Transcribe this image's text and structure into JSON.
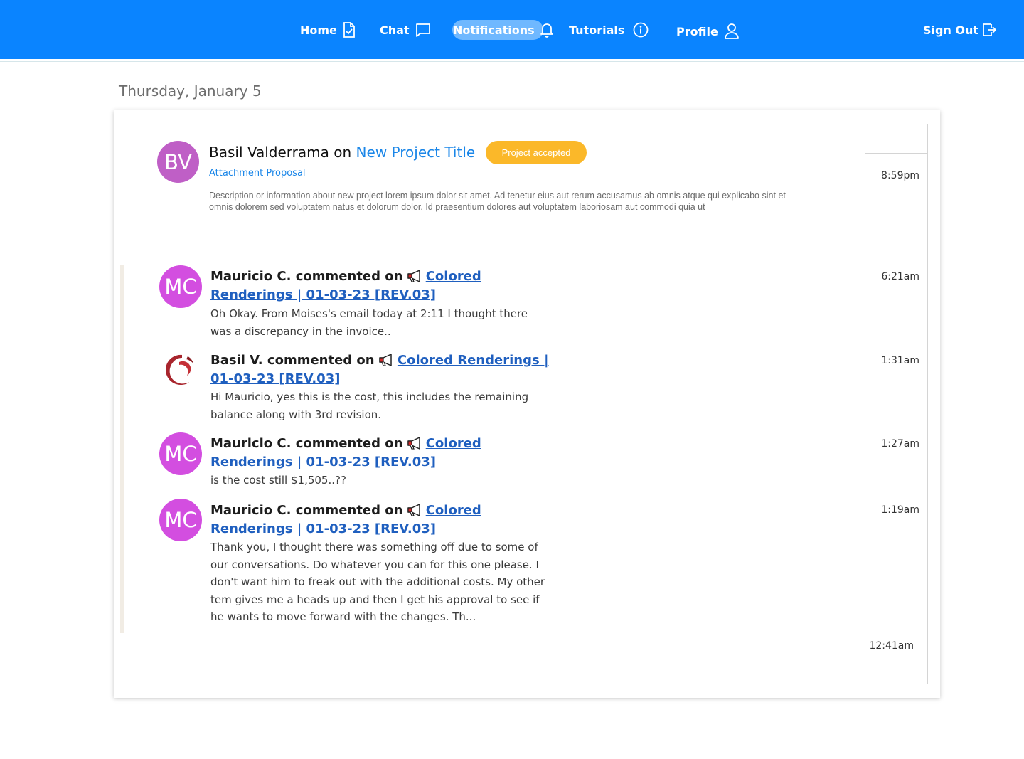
{
  "nav": {
    "home": "Home",
    "chat": "Chat",
    "notifications": "Notifications",
    "tutorials": "Tutorials",
    "profile": "Profile",
    "sign_out": "Sign Out"
  },
  "colors": {
    "nav_bg": "#0a84ff",
    "badge": "#fbb829",
    "link": "#1a86e8",
    "avatar_bv": "#bf5fc6",
    "avatar_mc": "#d34ee0"
  },
  "date_heading": "Thursday, January 5",
  "project_notification": {
    "avatar_initials": "BV",
    "author": "Basil Valderrama",
    "connector": "on",
    "project_title": "New Project Title",
    "badge": "Project accepted",
    "attachment": "Attachment Proposal",
    "description": "Description or information about new project lorem ipsum dolor sit amet. Ad tenetur eius aut rerum accusamus ab omnis atque qui explicabo sint et omnis dolorem sed voluptatem natus et dolorum dolor. Id praesentium dolores aut voluptatem laboriosam aut commodi quia ut",
    "time": "8:59pm"
  },
  "comments": [
    {
      "avatar": "MC",
      "author_line": "Mauricio C. commented on",
      "link_icon": "megaphone-icon",
      "link": "Colored Renderings | 01-03-23 [REV.03]",
      "body": "Oh Okay.  From Moises's email today at  2:11 I thought there was a discrepancy in the invoice..",
      "time": "6:21am"
    },
    {
      "avatar": "logo",
      "author_line": "Basil V. commented on",
      "link_icon": "megaphone-icon",
      "link": "Colored Renderings | 01-03-23 [REV.03]",
      "body": "Hi Mauricio, yes this is the cost, this includes the remaining balance along with 3rd revision.",
      "time": "1:31am"
    },
    {
      "avatar": "MC",
      "author_line": "Mauricio C. commented on",
      "link_icon": "megaphone-icon",
      "link": "Colored Renderings | 01-03-23 [REV.03]",
      "body": "is the cost still $1,505..??",
      "time": "1:27am"
    },
    {
      "avatar": "MC",
      "author_line": "Mauricio C. commented on",
      "link_icon": "megaphone-icon",
      "link": "Colored Renderings | 01-03-23 [REV.03]",
      "body": "Thank you, I thought there was something off due to some of our conversations.  Do whatever you can for this one please.  I don't want him to freak out with the additional costs.  My other tem gives me a heads up and then I get his approval to see if he wants to move forward with the changes.  Th...",
      "time": "1:19am"
    }
  ],
  "footer_time": "12:41am"
}
